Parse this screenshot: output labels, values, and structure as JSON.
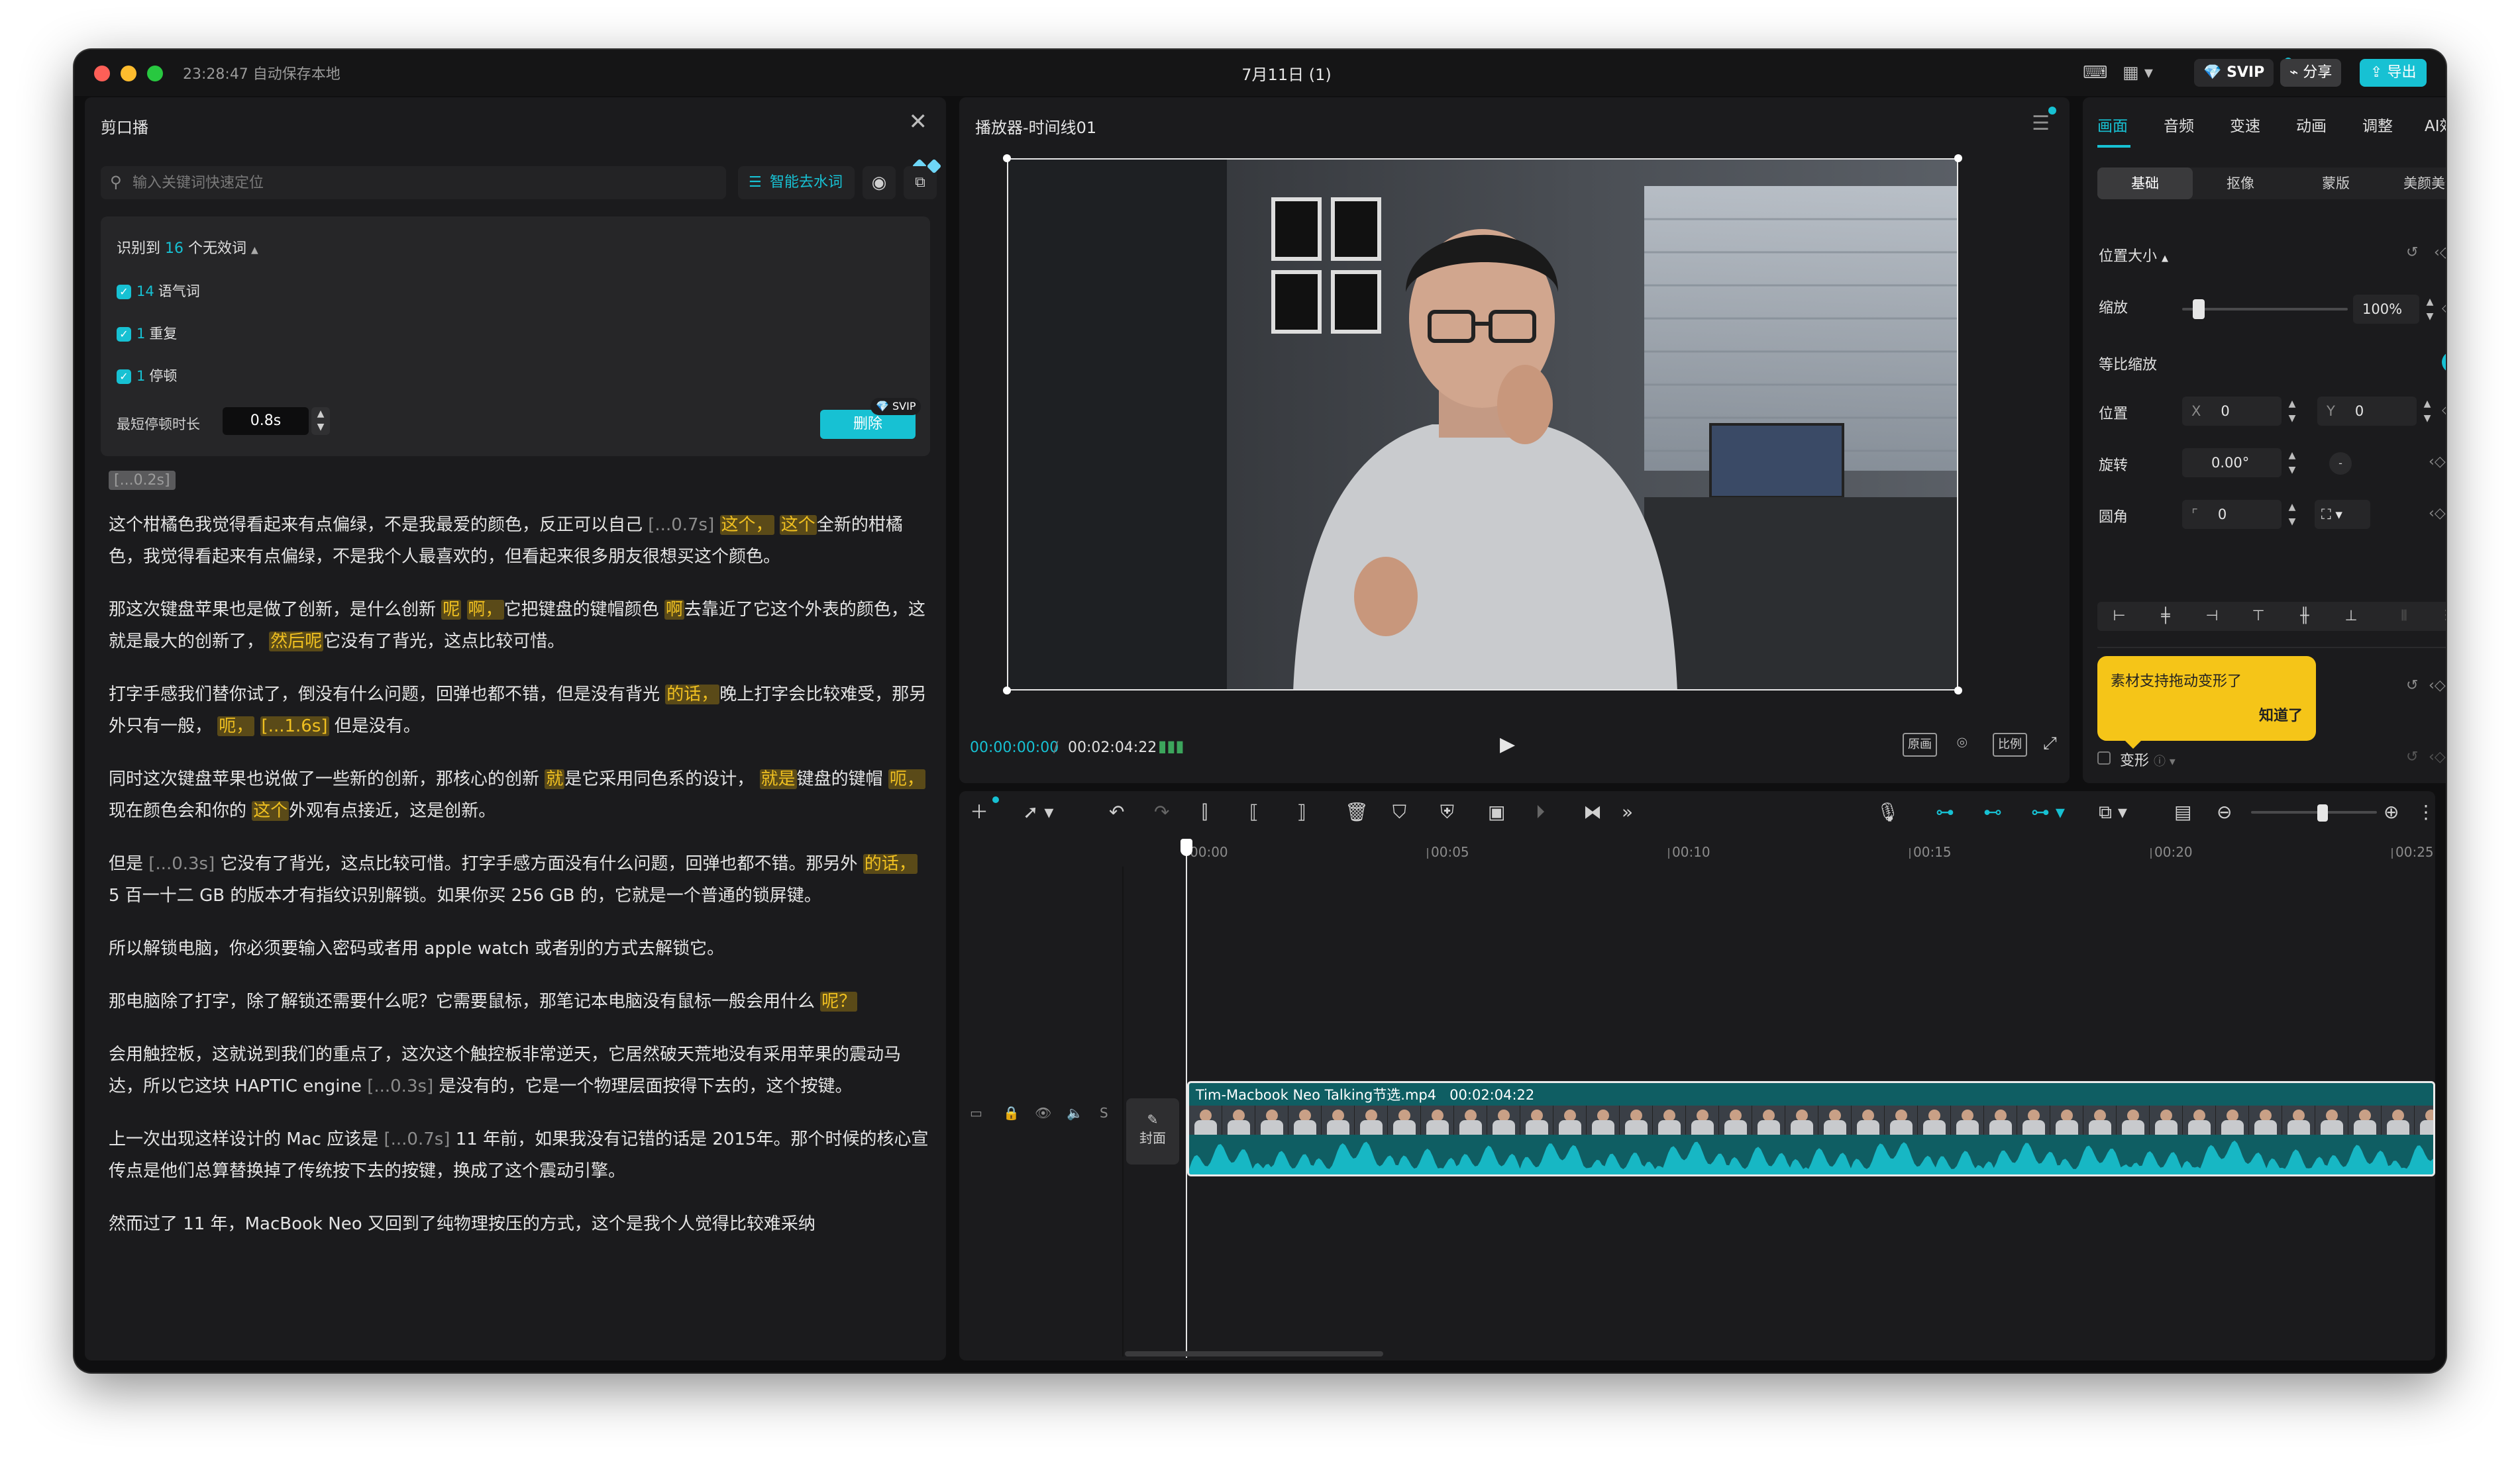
{
  "app": {
    "autosave": "23:28:47 自动保存本地",
    "doc_title": "7月11日 (1)",
    "svip": "SVIP",
    "share": "分享",
    "export": "导出"
  },
  "left": {
    "title": "剪口播",
    "search_placeholder": "输入关键词快速定位",
    "smart_btn": "智能去水词",
    "detect_prefix": "识别到",
    "detect_count": "16",
    "detect_suffix": "个无效词",
    "checks": [
      {
        "num": "14",
        "label": "语气词"
      },
      {
        "num": "1",
        "label": "重复"
      },
      {
        "num": "1",
        "label": "停顿"
      }
    ],
    "min_pause_label": "最短停顿时长",
    "min_pause_value": "0.8s",
    "delete_btn": "删除",
    "svip_tag": "SVIP",
    "top_pause": "[...0.2s]"
  },
  "transcript": [
    [
      {
        "t": "这个柑橘色我觉得看起来有点偏绿，不是我最爱的颜色，反正可以自己 "
      },
      {
        "t": "[...0.7s]",
        "c": "ps"
      },
      {
        "t": " "
      },
      {
        "t": "这个，",
        "c": "hl"
      },
      {
        "t": " "
      },
      {
        "t": "这个",
        "c": "hl"
      },
      {
        "t": "全新的柑橘色，我觉得看起来有点偏绿，不是我个人最喜欢的，但看起来很多朋友很想买这个颜色。"
      }
    ],
    [
      {
        "t": "那这次键盘苹果也是做了创新，是什么创新 "
      },
      {
        "t": "呢",
        "c": "hl"
      },
      {
        "t": " "
      },
      {
        "t": "啊，",
        "c": "hl"
      },
      {
        "t": "它把键盘的键帽颜色 "
      },
      {
        "t": "啊",
        "c": "hl"
      },
      {
        "t": "去靠近了它这个外表的颜色，这就是最大的创新了，  "
      },
      {
        "t": "然后呢",
        "c": "hl"
      },
      {
        "t": "它没有了背光，这点比较可惜。"
      }
    ],
    [
      {
        "t": "打字手感我们替你试了，倒没有什么问题，回弹也都不错，但是没有背光 "
      },
      {
        "t": "的话，",
        "c": "hl"
      },
      {
        "t": "晚上打字会比较难受，那另外只有一般， "
      },
      {
        "t": "呃，",
        "c": "hl"
      },
      {
        "t": " "
      },
      {
        "t": "[...1.6s]",
        "c": "hl"
      },
      {
        "t": " 但是没有。"
      }
    ],
    [
      {
        "t": "同时这次键盘苹果也说做了一些新的创新，那核心的创新 "
      },
      {
        "t": "就",
        "c": "hl"
      },
      {
        "t": "是它采用同色系的设计， "
      },
      {
        "t": "就是",
        "c": "hl"
      },
      {
        "t": "键盘的键帽 "
      },
      {
        "t": "呃，",
        "c": "hl"
      },
      {
        "t": "现在颜色会和你的 "
      },
      {
        "t": "这个",
        "c": "hl"
      },
      {
        "t": "外观有点接近，这是创新。"
      }
    ],
    [
      {
        "t": "但是 "
      },
      {
        "t": "[...0.3s]",
        "c": "ps"
      },
      {
        "t": " 它没有了背光，这点比较可惜。打字手感方面没有什么问题，回弹也都不错。那另外 "
      },
      {
        "t": "的话，",
        "c": "hl"
      },
      {
        "t": " 5 百一十二 GB 的版本才有指纹识别解锁。如果你买 256 GB 的，它就是一个普通的锁屏键。"
      }
    ],
    [
      {
        "t": "所以解锁电脑，你必须要输入密码或者用 apple watch 或者别的方式去解锁它。"
      }
    ],
    [
      {
        "t": "那电脑除了打字，除了解锁还需要什么呢？它需要鼠标，那笔记本电脑没有鼠标一般会用什么 "
      },
      {
        "t": "呢？",
        "c": "hl"
      }
    ],
    [
      {
        "t": "会用触控板，这就说到我们的重点了，这次这个触控板非常逆天，它居然破天荒地没有采用苹果的震动马达，所以它这块 HAPTIC engine "
      },
      {
        "t": "[...0.3s]",
        "c": "ps"
      },
      {
        "t": " 是没有的，它是一个物理层面按得下去的，这个按键。"
      }
    ],
    [
      {
        "t": "上一次出现这样设计的 Mac 应该是 "
      },
      {
        "t": "[...0.7s]",
        "c": "ps"
      },
      {
        "t": " 11 年前，如果我没有记错的话是 2015年。那个时候的核心宣传点是他们总算替换掉了传统按下去的按键，换成了这个震动引擎。"
      }
    ],
    [
      {
        "t": "然而过了 11 年，MacBook Neo 又回到了纯物理按压的方式，这个是我个人觉得比较难采纳"
      }
    ]
  ],
  "player": {
    "title": "播放器-时间线01",
    "time_current": "00:00:00:00",
    "time_total": "00:02:04:22",
    "btn_original": "原画",
    "btn_ratio": "比例"
  },
  "right": {
    "tabs": [
      "画面",
      "音频",
      "变速",
      "动画",
      "调整",
      "AI效果"
    ],
    "subtabs": [
      "基础",
      "抠像",
      "蒙版",
      "美颜美体"
    ],
    "section_pos_size": "位置大小",
    "scale_label": "缩放",
    "scale_value": "100%",
    "scale_level": 0.1,
    "uniform_label": "等比缩放",
    "position_label": "位置",
    "x_label": "X",
    "x_value": "0",
    "y_label": "Y",
    "y_value": "0",
    "rotate_label": "旋转",
    "rotate_value": "0.00°",
    "corner_label": "圆角",
    "corner_value": "0",
    "tooltip_text": "素材支持拖动变形了",
    "tooltip_ok": "知道了",
    "transform_label": "变形"
  },
  "timeline": {
    "ticks": [
      "00:00",
      "00:05",
      "00:10",
      "00:15",
      "00:20",
      "00:25"
    ],
    "track_controls": [
      "▶",
      "🔒",
      "👁",
      "🔈",
      "S"
    ],
    "cover_label": "封面",
    "clip_name": "Tim-Macbook Neo Talking节选.mp4",
    "clip_duration": "00:02:04:22"
  },
  "colors": {
    "accent": "#17c1d3",
    "highlight": "#f0c020",
    "tooltip": "#f5c518"
  }
}
